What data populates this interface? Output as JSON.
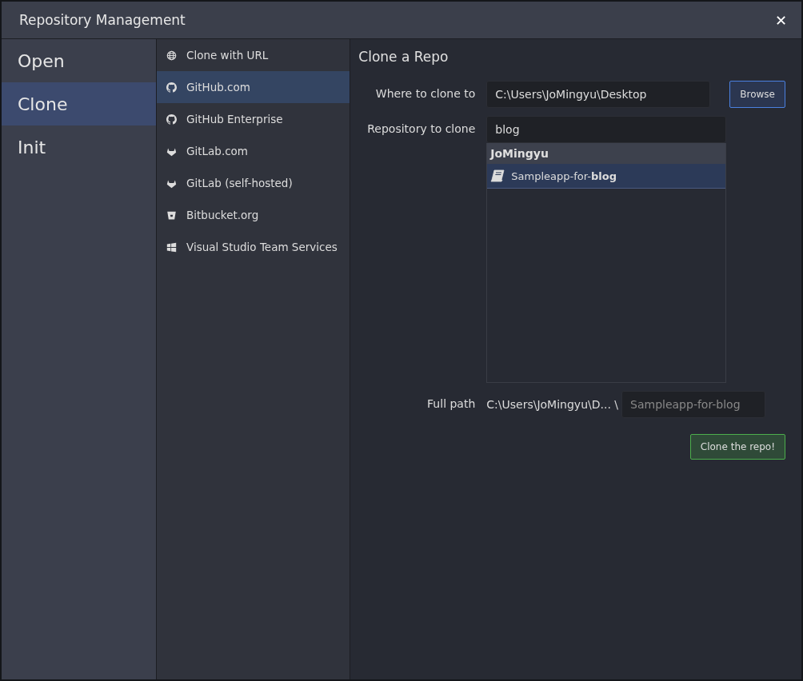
{
  "window": {
    "title": "Repository Management",
    "close": "✕"
  },
  "modes": [
    {
      "label": "Open",
      "selected": false
    },
    {
      "label": "Clone",
      "selected": true
    },
    {
      "label": "Init",
      "selected": false
    }
  ],
  "sources": [
    {
      "label": "Clone with URL",
      "kind": "globe",
      "selected": false
    },
    {
      "label": "GitHub.com",
      "kind": "github",
      "selected": true
    },
    {
      "label": "GitHub Enterprise",
      "kind": "github",
      "selected": false
    },
    {
      "label": "GitLab.com",
      "kind": "gitlab",
      "selected": false
    },
    {
      "label": "GitLab (self-hosted)",
      "kind": "gitlab",
      "selected": false
    },
    {
      "label": "Bitbucket.org",
      "kind": "bitbucket",
      "selected": false
    },
    {
      "label": "Visual Studio Team Services",
      "kind": "windows",
      "selected": false
    }
  ],
  "panel": {
    "title": "Clone a Repo",
    "where_label": "Where to clone to",
    "where_value": "C:\\Users\\JoMingyu\\Desktop",
    "browse": "Browse",
    "repo_label": "Repository to clone",
    "repo_value": "blog",
    "results": [
      {
        "group": "JoMingyu",
        "repos": [
          {
            "name": "Sampleapp-for-**blog**",
            "selected": true
          }
        ]
      }
    ],
    "full_path_label": "Full path",
    "full_path_prefix": "C:\\Users\\JoMingyu\\D... \\",
    "full_path_placeholder": "Sampleapp-for-blog",
    "clone_button": "Clone the repo!"
  }
}
